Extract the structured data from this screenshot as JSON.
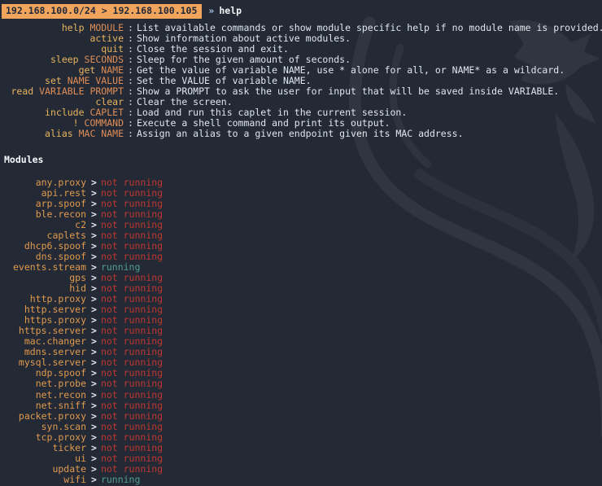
{
  "terminal": {
    "title": "bettercap interactive session",
    "background_color": "#242a35",
    "watermark_icon": "kali-dragon-watermark"
  },
  "prompt": {
    "subnet": "192.168.100.0/24",
    "separator": " > ",
    "host": "192.168.100.105",
    "chip_text": "192.168.100.0/24 > 192.168.100.105",
    "arrow": "»",
    "command": "help",
    "chip_bg": "#f0a45c",
    "chip_fg": "#23293a"
  },
  "help": {
    "colon": ":",
    "rows": [
      {
        "cmd": "help",
        "arg": "MODULE",
        "desc": "List available commands or show module specific help if no module name is provided."
      },
      {
        "cmd": "active",
        "arg": "",
        "desc": "Show information about active modules."
      },
      {
        "cmd": "quit",
        "arg": "",
        "desc": "Close the session and exit."
      },
      {
        "cmd": "sleep",
        "arg": "SECONDS",
        "desc": "Sleep for the given amount of seconds."
      },
      {
        "cmd": "get",
        "arg": "NAME",
        "desc": "Get the value of variable NAME, use * alone for all, or NAME* as a wildcard."
      },
      {
        "cmd": "set",
        "arg": "NAME VALUE",
        "desc": "Set the VALUE of variable NAME."
      },
      {
        "cmd": "read",
        "arg": "VARIABLE PROMPT",
        "desc": "Show a PROMPT to ask the user for input that will be saved inside VARIABLE."
      },
      {
        "cmd": "clear",
        "arg": "",
        "desc": "Clear the screen."
      },
      {
        "cmd": "include",
        "arg": "CAPLET",
        "desc": "Load and run this caplet in the current session."
      },
      {
        "cmd": "!",
        "arg": "COMMAND",
        "desc": "Execute a shell command and print its output."
      },
      {
        "cmd": "alias",
        "arg": "MAC NAME",
        "desc": "Assign an alias to a given endpoint given its MAC address."
      }
    ]
  },
  "modules": {
    "heading": "Modules",
    "arrow": ">",
    "state_running": "running",
    "state_not_running": "not running",
    "colors": {
      "name": "#e09a4e",
      "running": "#4f9f8c",
      "not_running": "#bf3630"
    },
    "items": [
      {
        "name": "any.proxy",
        "state": "not running"
      },
      {
        "name": "api.rest",
        "state": "not running"
      },
      {
        "name": "arp.spoof",
        "state": "not running"
      },
      {
        "name": "ble.recon",
        "state": "not running"
      },
      {
        "name": "c2",
        "state": "not running"
      },
      {
        "name": "caplets",
        "state": "not running"
      },
      {
        "name": "dhcp6.spoof",
        "state": "not running"
      },
      {
        "name": "dns.spoof",
        "state": "not running"
      },
      {
        "name": "events.stream",
        "state": "running"
      },
      {
        "name": "gps",
        "state": "not running"
      },
      {
        "name": "hid",
        "state": "not running"
      },
      {
        "name": "http.proxy",
        "state": "not running"
      },
      {
        "name": "http.server",
        "state": "not running"
      },
      {
        "name": "https.proxy",
        "state": "not running"
      },
      {
        "name": "https.server",
        "state": "not running"
      },
      {
        "name": "mac.changer",
        "state": "not running"
      },
      {
        "name": "mdns.server",
        "state": "not running"
      },
      {
        "name": "mysql.server",
        "state": "not running"
      },
      {
        "name": "ndp.spoof",
        "state": "not running"
      },
      {
        "name": "net.probe",
        "state": "not running"
      },
      {
        "name": "net.recon",
        "state": "not running"
      },
      {
        "name": "net.sniff",
        "state": "not running"
      },
      {
        "name": "packet.proxy",
        "state": "not running"
      },
      {
        "name": "syn.scan",
        "state": "not running"
      },
      {
        "name": "tcp.proxy",
        "state": "not running"
      },
      {
        "name": "ticker",
        "state": "not running"
      },
      {
        "name": "ui",
        "state": "not running"
      },
      {
        "name": "update",
        "state": "not running"
      },
      {
        "name": "wifi",
        "state": "running"
      }
    ]
  }
}
